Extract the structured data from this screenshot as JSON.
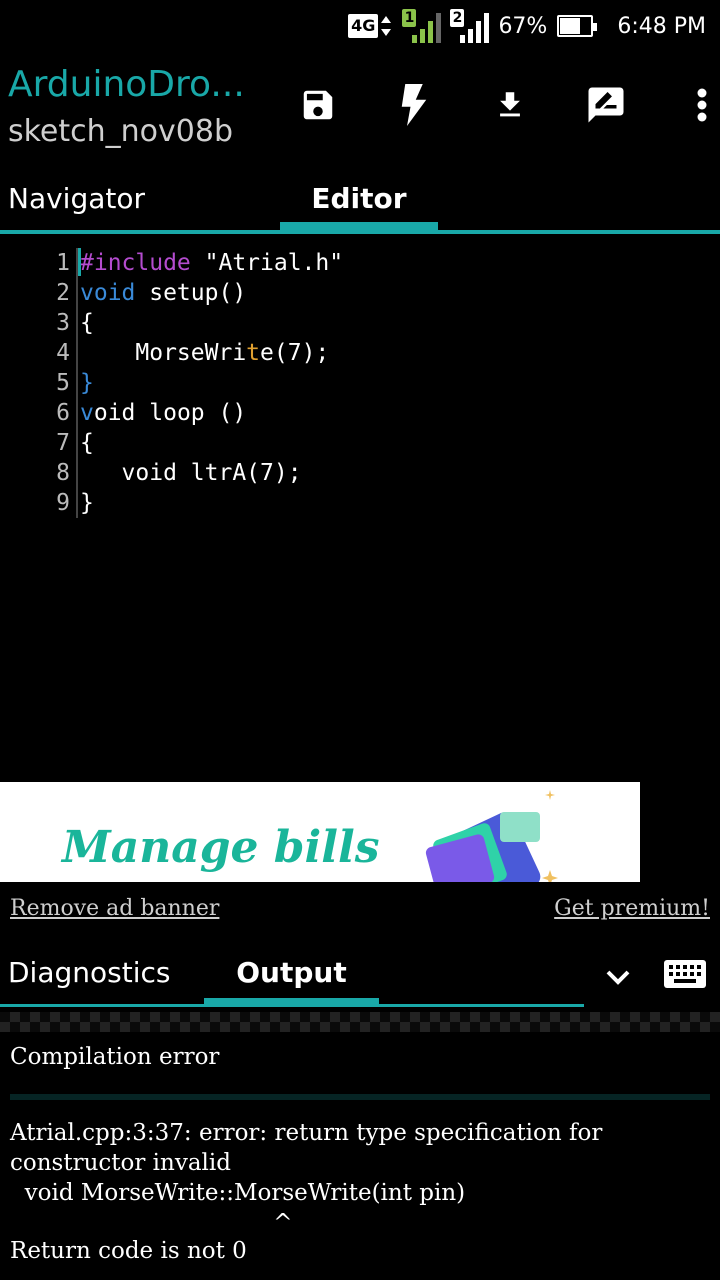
{
  "status_bar": {
    "network": "4G",
    "sim1": "1",
    "sim2": "2",
    "battery_text": "67%",
    "battery_level": 0.67,
    "time": "6:48 PM",
    "sim1_color": "#8bc34a"
  },
  "app_bar": {
    "title": "ArduinoDro...",
    "subtitle": "sketch_nov08b",
    "actions": [
      "save-icon",
      "flash-icon",
      "download-icon",
      "edit-note-icon",
      "more-vert-icon"
    ]
  },
  "tabs": {
    "navigator": "Navigator",
    "editor": "Editor",
    "active": "Editor"
  },
  "editor": {
    "lines": [
      {
        "n": "1",
        "segments": [
          {
            "t": "#include",
            "c": "kw-purple"
          },
          {
            "t": " \"Atrial.h\"",
            "c": ""
          }
        ]
      },
      {
        "n": "2",
        "segments": [
          {
            "t": "void",
            "c": "kw-blue"
          },
          {
            "t": " setup()",
            "c": ""
          }
        ]
      },
      {
        "n": "3",
        "segments": [
          {
            "t": "{",
            "c": ""
          }
        ]
      },
      {
        "n": "4",
        "segments": [
          {
            "t": "    MorseWri",
            "c": ""
          },
          {
            "t": "t",
            "c": "kw-orange"
          },
          {
            "t": "e(7);",
            "c": ""
          }
        ]
      },
      {
        "n": "5",
        "segments": [
          {
            "t": "}",
            "c": "kw-blue"
          }
        ]
      },
      {
        "n": "6",
        "segments": [
          {
            "t": "v",
            "c": "kw-blue"
          },
          {
            "t": "oid loop ()",
            "c": ""
          }
        ]
      },
      {
        "n": "7",
        "segments": [
          {
            "t": "{",
            "c": ""
          }
        ]
      },
      {
        "n": "8",
        "segments": [
          {
            "t": "   void ltrA(7);",
            "c": ""
          }
        ]
      },
      {
        "n": "9",
        "segments": [
          {
            "t": "}",
            "c": ""
          }
        ]
      }
    ]
  },
  "ad": {
    "headline": "Manage bills",
    "remove_label": "Remove ad banner",
    "premium_label": "Get premium!"
  },
  "bottom_tabs": {
    "diagnostics": "Diagnostics",
    "output": "Output",
    "active": "Output"
  },
  "output": {
    "status": "Compilation error",
    "message": "Atrial.cpp:3:37: error: return type specification for\nconstructor invalid\n  void MorseWrite::MorseWrite(int pin)\n                                    ^",
    "return_code": "Return code is not 0"
  },
  "colors": {
    "accent": "#19a8a8",
    "background": "#000000"
  }
}
